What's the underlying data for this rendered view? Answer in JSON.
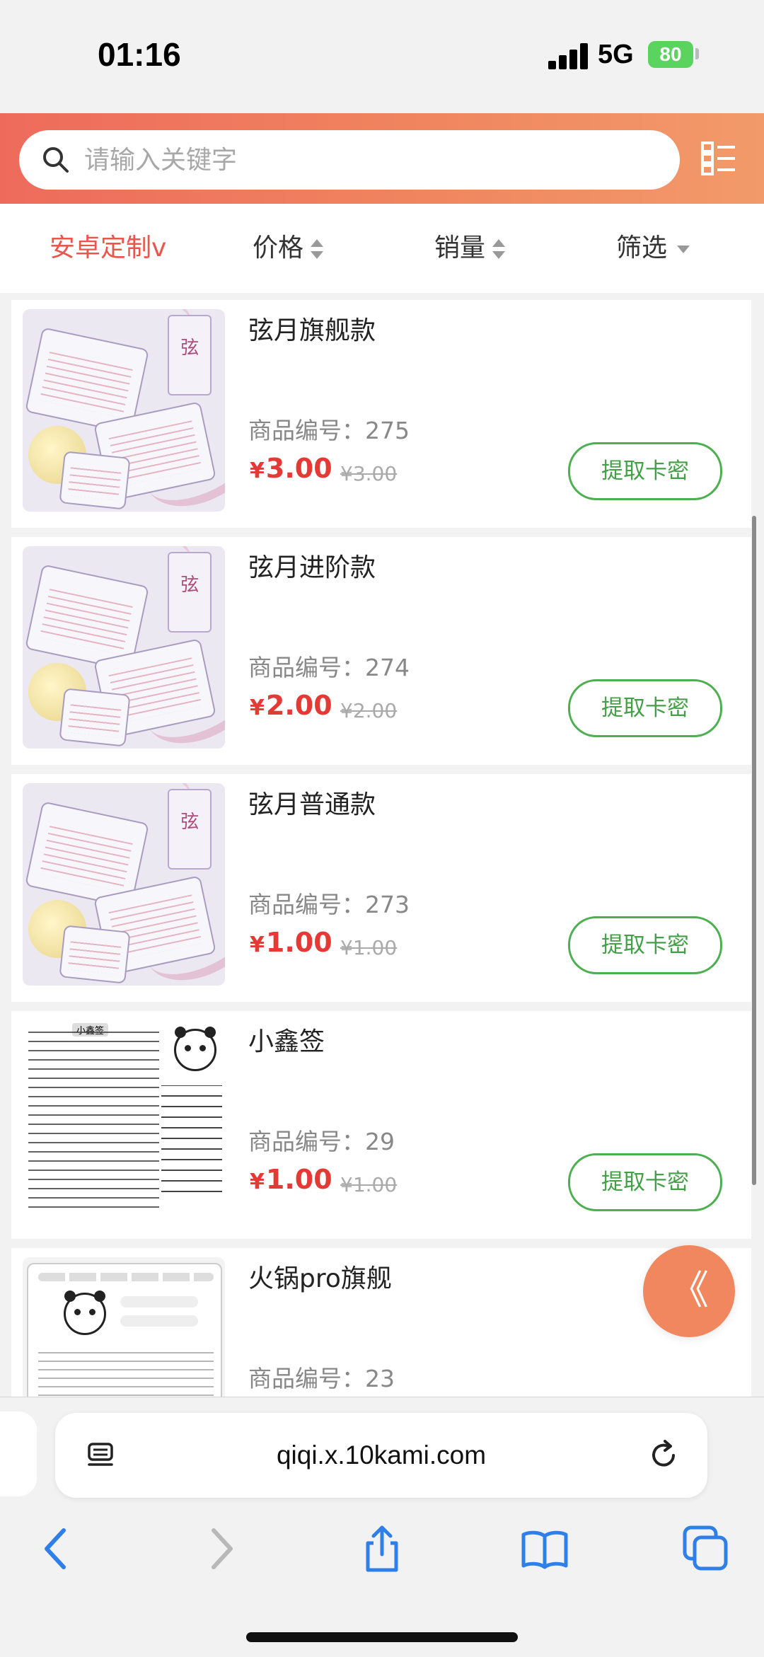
{
  "status_bar": {
    "time": "01:16",
    "network": "5G",
    "battery": "80"
  },
  "search": {
    "placeholder": "请输入关键字"
  },
  "filters": [
    {
      "label": "安卓定制v",
      "active": true
    },
    {
      "label": "价格",
      "control": "sort"
    },
    {
      "label": "销量",
      "control": "sort"
    },
    {
      "label": "筛选",
      "control": "dropdown"
    }
  ],
  "code_prefix": "商品编号：",
  "currency": "¥",
  "products": [
    {
      "name": "弦月旗舰款",
      "code": "275",
      "price": "3.00",
      "original_price": "¥3.00",
      "button": "提取卡密",
      "thumb": "moon-art"
    },
    {
      "name": "弦月进阶款",
      "code": "274",
      "price": "2.00",
      "original_price": "¥2.00",
      "button": "提取卡密",
      "thumb": "moon-art"
    },
    {
      "name": "弦月普通款",
      "code": "273",
      "price": "1.00",
      "original_price": "¥1.00",
      "button": "提取卡密",
      "thumb": "moon-art"
    },
    {
      "name": "小鑫签",
      "code": "29",
      "price": "1.00",
      "original_price": "¥1.00",
      "button": "提取卡密",
      "thumb": "text-flyer",
      "thumb_title": "小鑫签"
    },
    {
      "name": "火锅pro旗舰",
      "code": "23",
      "thumb": "app-screenshot"
    }
  ],
  "thumb_glyph": "弦",
  "fab": {
    "glyph": "《"
  },
  "browser": {
    "url": "qiqi.x.10kami.com"
  },
  "colors": {
    "accent": "#e9564b",
    "price": "#e53935",
    "button_green": "#43a047",
    "header_start": "#ee6b5c",
    "header_end": "#f29a6a",
    "fab": "#f0875e"
  }
}
